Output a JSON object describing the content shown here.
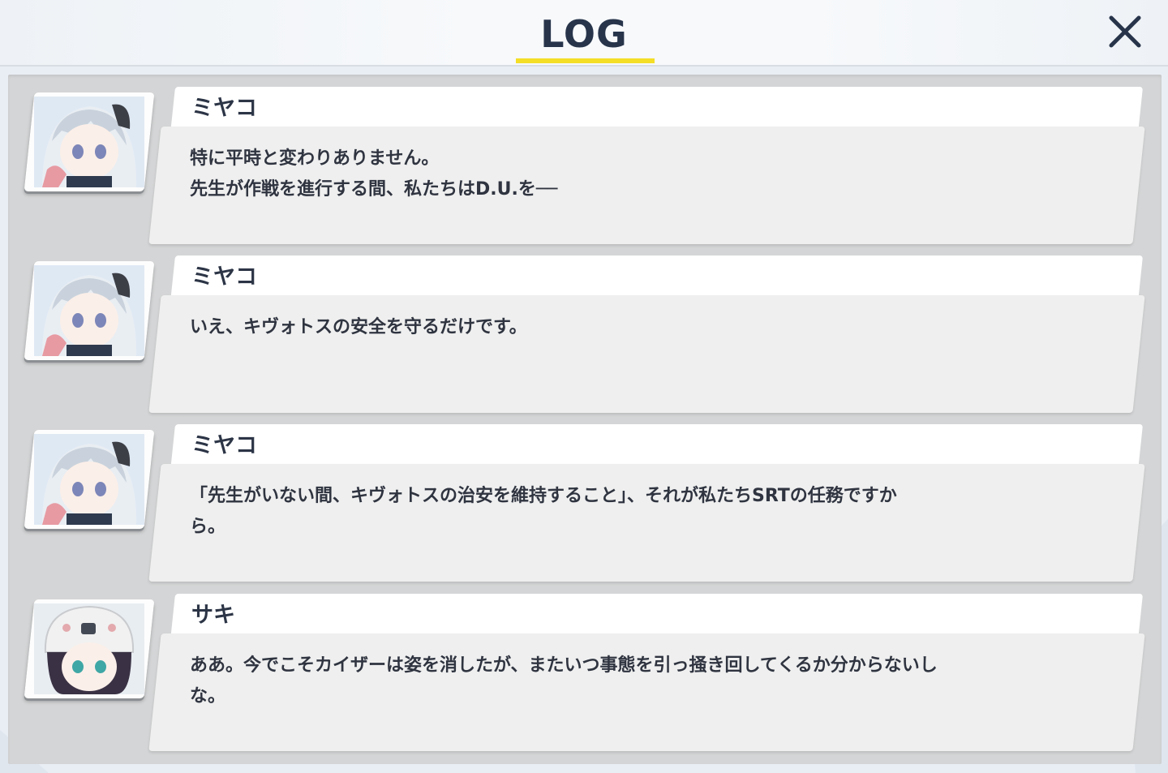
{
  "header": {
    "title": "LOG",
    "close_icon": "close-icon"
  },
  "colors": {
    "accent": "#f4de26",
    "title": "#27344a",
    "panel": "#d4d5d6",
    "bubble": "#efefef"
  },
  "entries": [
    {
      "speaker": "ミヤコ",
      "avatar": "miyako-portrait",
      "text": "特に平時と変わりありません。\n先生が作戦を進行する間、私たちはD.U.を──"
    },
    {
      "speaker": "ミヤコ",
      "avatar": "miyako-portrait",
      "text": "いえ、キヴォトスの安全を守るだけです。"
    },
    {
      "speaker": "ミヤコ",
      "avatar": "miyako-portrait",
      "text": "「先生がいない間、キヴォトスの治安を維持すること」、それが私たちSRTの任務ですか\nら。"
    },
    {
      "speaker": "サキ",
      "avatar": "saki-portrait",
      "text": "ああ。今でこそカイザーは姿を消したが、またいつ事態を引っ掻き回してくるか分からないし\nな。"
    }
  ]
}
